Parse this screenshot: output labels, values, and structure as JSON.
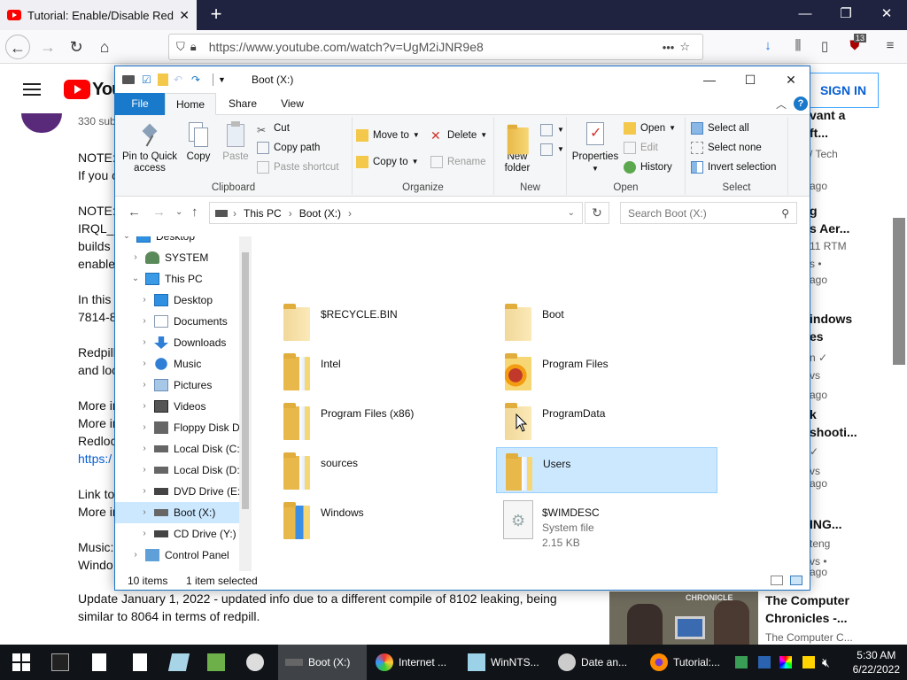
{
  "browser": {
    "tab_title": "Tutorial: Enable/Disable Redpill",
    "url": "https://www.youtube.com/watch?v=UgM2iJNR9e8",
    "ext_badge": "13"
  },
  "youtube": {
    "signin": "SIGN IN",
    "subs": "330 sub",
    "desc_lines": [
      {
        "text": "NOTE:",
        "link": false
      },
      {
        "text": "If you c",
        "link": false
      },
      {
        "text": "NOTE:",
        "link": false
      },
      {
        "text": "IRQL_N",
        "link": false
      },
      {
        "text": "builds",
        "link": false
      },
      {
        "text": "enable",
        "link": false
      },
      {
        "text": "In this",
        "link": false
      },
      {
        "text": "7814-8",
        "link": false
      },
      {
        "text": "Redpill",
        "link": false
      },
      {
        "text": "and loc",
        "link": false
      },
      {
        "text": "More in",
        "link": false
      },
      {
        "text": "More in",
        "link": false
      },
      {
        "text": "Redloc",
        "link": false
      },
      {
        "text": "https:/",
        "link": true
      },
      {
        "text": "Link to",
        "link": false
      },
      {
        "text": "More in",
        "link": false
      },
      {
        "text": "Music:",
        "link": false
      },
      {
        "text": "Windo",
        "link": false
      }
    ],
    "update_line1": "Update January 1, 2022 - updated info due to a different compile of 8102 leaking, being",
    "update_line2": "similar to 8064 in terms of redpill.",
    "related": [
      {
        "text": "vant a",
        "cls": "b"
      },
      {
        "text": "ft...",
        "cls": "b"
      },
      {
        "text": "/ Tech",
        "cls": "g"
      },
      {
        "text": "ago",
        "cls": "g"
      },
      {
        "text": "g",
        "cls": "b"
      },
      {
        "text": "s Aer...",
        "cls": "b"
      },
      {
        "text": "11 RTM",
        "cls": "g"
      },
      {
        "text": "s •",
        "cls": "g"
      },
      {
        "text": "ago",
        "cls": "g"
      },
      {
        "text": "indows",
        "cls": "b"
      },
      {
        "text": "es",
        "cls": "b"
      },
      {
        "text": "n ✓",
        "cls": "g"
      },
      {
        "text": "vs",
        "cls": "g"
      },
      {
        "text": "ago",
        "cls": "g"
      },
      {
        "text": "k",
        "cls": "b"
      },
      {
        "text": "shooti...",
        "cls": "b"
      },
      {
        "text": "✓",
        "cls": "g"
      },
      {
        "text": "vs",
        "cls": "g"
      },
      {
        "text": "ago",
        "cls": "g"
      },
      {
        "text": "ING...",
        "cls": "b"
      },
      {
        "text": "teng",
        "cls": "g"
      },
      {
        "text": "vs •",
        "cls": "g"
      },
      {
        "text": "ago",
        "cls": "g"
      }
    ],
    "thumb_label": "CHRONICLE",
    "related_video_title1": "The Computer",
    "related_video_title2": "Chronicles -...",
    "related_video_channel": "The Computer C..."
  },
  "explorer": {
    "title": "Boot (X:)",
    "tabs": [
      "File",
      "Home",
      "Share",
      "View"
    ],
    "ribbon": {
      "clipboard": {
        "label": "Clipboard",
        "pin": "Pin to Quick access",
        "copy": "Copy",
        "paste": "Paste",
        "cut": "Cut",
        "copy_path": "Copy path",
        "paste_shortcut": "Paste shortcut"
      },
      "organize": {
        "label": "Organize",
        "move_to": "Move to",
        "copy_to": "Copy to",
        "delete": "Delete",
        "rename": "Rename"
      },
      "new": {
        "label": "New",
        "new_folder": "New folder"
      },
      "open": {
        "label": "Open",
        "properties": "Properties",
        "open": "Open",
        "edit": "Edit",
        "history": "History"
      },
      "select": {
        "label": "Select",
        "select_all": "Select all",
        "select_none": "Select none",
        "invert": "Invert selection"
      }
    },
    "address": {
      "crumbs": [
        "This PC",
        "Boot (X:)"
      ],
      "search_placeholder": "Search Boot (X:)"
    },
    "nav": [
      {
        "label": "Desktop",
        "indent": 0,
        "expanded": true,
        "icon": "desktop"
      },
      {
        "label": "SYSTEM",
        "indent": 1,
        "expanded": false,
        "icon": "user"
      },
      {
        "label": "This PC",
        "indent": 1,
        "expanded": true,
        "icon": "pc"
      },
      {
        "label": "Desktop",
        "indent": 2,
        "expanded": false,
        "icon": "desktop"
      },
      {
        "label": "Documents",
        "indent": 2,
        "expanded": false,
        "icon": "docs"
      },
      {
        "label": "Downloads",
        "indent": 2,
        "expanded": false,
        "icon": "down"
      },
      {
        "label": "Music",
        "indent": 2,
        "expanded": false,
        "icon": "music"
      },
      {
        "label": "Pictures",
        "indent": 2,
        "expanded": false,
        "icon": "pics"
      },
      {
        "label": "Videos",
        "indent": 2,
        "expanded": false,
        "icon": "vid"
      },
      {
        "label": "Floppy Disk Dri",
        "indent": 2,
        "expanded": false,
        "icon": "floppy"
      },
      {
        "label": "Local Disk (C:)",
        "indent": 2,
        "expanded": false,
        "icon": "drive"
      },
      {
        "label": "Local Disk (D:)",
        "indent": 2,
        "expanded": false,
        "icon": "drive"
      },
      {
        "label": "DVD Drive (E:) I",
        "indent": 2,
        "expanded": false,
        "icon": "dvd"
      },
      {
        "label": "Boot (X:)",
        "indent": 2,
        "expanded": false,
        "icon": "drive",
        "selected": true
      },
      {
        "label": "CD Drive (Y:) H",
        "indent": 2,
        "expanded": false,
        "icon": "dvd"
      },
      {
        "label": "Control Panel",
        "indent": 1,
        "expanded": false,
        "icon": "cp"
      }
    ],
    "items": [
      {
        "name": "$RECYCLE.BIN",
        "icon": "pale",
        "col": 0,
        "row": 0
      },
      {
        "name": "Boot",
        "icon": "pale",
        "col": 1,
        "row": 0
      },
      {
        "name": "Intel",
        "icon": "doc",
        "col": 0,
        "row": 1
      },
      {
        "name": "Program Files",
        "icon": "pf",
        "col": 1,
        "row": 1
      },
      {
        "name": "Program Files (x86)",
        "icon": "doc",
        "col": 0,
        "row": 2
      },
      {
        "name": "ProgramData",
        "icon": "pale",
        "col": 1,
        "row": 2
      },
      {
        "name": "sources",
        "icon": "doc",
        "col": 0,
        "row": 3
      },
      {
        "name": "Users",
        "icon": "doc",
        "col": 1,
        "row": 3,
        "selected": true
      },
      {
        "name": "Windows",
        "icon": "win",
        "col": 0,
        "row": 4
      },
      {
        "name": "$WIMDESC",
        "icon": "sysfile",
        "col": 1,
        "row": 4,
        "sub1": "System file",
        "sub2": "2.15 KB"
      }
    ],
    "status": {
      "count": "10 items",
      "selected": "1 item selected"
    }
  },
  "taskbar": {
    "apps": [
      {
        "label": "Boot (X:)",
        "active": true
      },
      {
        "label": "Internet ...",
        "active": false
      },
      {
        "label": "WinNTS...",
        "active": false
      },
      {
        "label": "Date an...",
        "active": false
      },
      {
        "label": "Tutorial:...",
        "active": false
      }
    ],
    "time": "5:30 AM",
    "date": "6/22/2022"
  }
}
